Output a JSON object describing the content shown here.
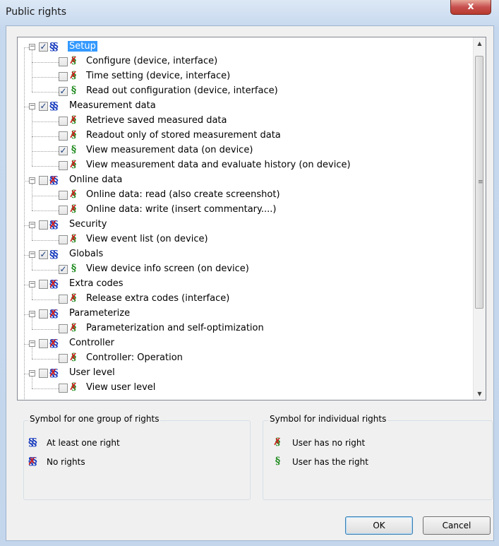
{
  "window": {
    "title": "Public rights",
    "close_glyph": "x"
  },
  "icons": {
    "group_symbol": "§§",
    "individual_symbol": "§",
    "no_right_mark": "✗"
  },
  "colors": {
    "group_blue": "#1a3dbf",
    "right_green": "#1f8a1f",
    "no_red": "#d11b1b",
    "selection": "#3399ff"
  },
  "tree": {
    "groups": [
      {
        "label": "Setup",
        "checked": true,
        "has_rights": true,
        "selected": true,
        "items": [
          {
            "label": "Configure (device, interface)",
            "checked": false,
            "has_right": false
          },
          {
            "label": "Time setting (device, interface)",
            "checked": false,
            "has_right": false
          },
          {
            "label": "Read out configuration (device, interface)",
            "checked": true,
            "has_right": true
          }
        ]
      },
      {
        "label": "Measurement data",
        "checked": true,
        "has_rights": true,
        "items": [
          {
            "label": "Retrieve saved measured data",
            "checked": false,
            "has_right": false
          },
          {
            "label": "Readout only of stored measurement data",
            "checked": false,
            "has_right": false
          },
          {
            "label": "View measurement data (on device)",
            "checked": true,
            "has_right": true
          },
          {
            "label": "View measurement data and evaluate history (on device)",
            "checked": false,
            "has_right": false
          }
        ]
      },
      {
        "label": "Online data",
        "checked": false,
        "has_rights": false,
        "items": [
          {
            "label": "Online data: read (also create screenshot)",
            "checked": false,
            "has_right": false
          },
          {
            "label": "Online data: write (insert commentary....)",
            "checked": false,
            "has_right": false
          }
        ]
      },
      {
        "label": "Security",
        "checked": false,
        "has_rights": false,
        "items": [
          {
            "label": "View event list (on device)",
            "checked": false,
            "has_right": false
          }
        ]
      },
      {
        "label": "Globals",
        "checked": true,
        "has_rights": true,
        "items": [
          {
            "label": "View device info screen (on device)",
            "checked": true,
            "has_right": true
          }
        ]
      },
      {
        "label": "Extra codes",
        "checked": false,
        "has_rights": false,
        "items": [
          {
            "label": "Release extra codes (interface)",
            "checked": false,
            "has_right": false
          }
        ]
      },
      {
        "label": "Parameterize",
        "checked": false,
        "has_rights": false,
        "items": [
          {
            "label": "Parameterization and self-optimization",
            "checked": false,
            "has_right": false
          }
        ]
      },
      {
        "label": "Controller",
        "checked": false,
        "has_rights": false,
        "items": [
          {
            "label": "Controller: Operation",
            "checked": false,
            "has_right": false
          }
        ]
      },
      {
        "label": "User level",
        "checked": false,
        "has_rights": false,
        "items": [
          {
            "label": "View user level",
            "checked": false,
            "has_right": false
          }
        ]
      }
    ]
  },
  "legend_groups": {
    "title": "Symbol for one group of rights",
    "at_least_one": "At least one right",
    "no_rights": "No rights"
  },
  "legend_individual": {
    "title": "Symbol for individual rights",
    "no_right": "User has no right",
    "has_right": "User has the right"
  },
  "buttons": {
    "ok": "OK",
    "cancel": "Cancel"
  }
}
